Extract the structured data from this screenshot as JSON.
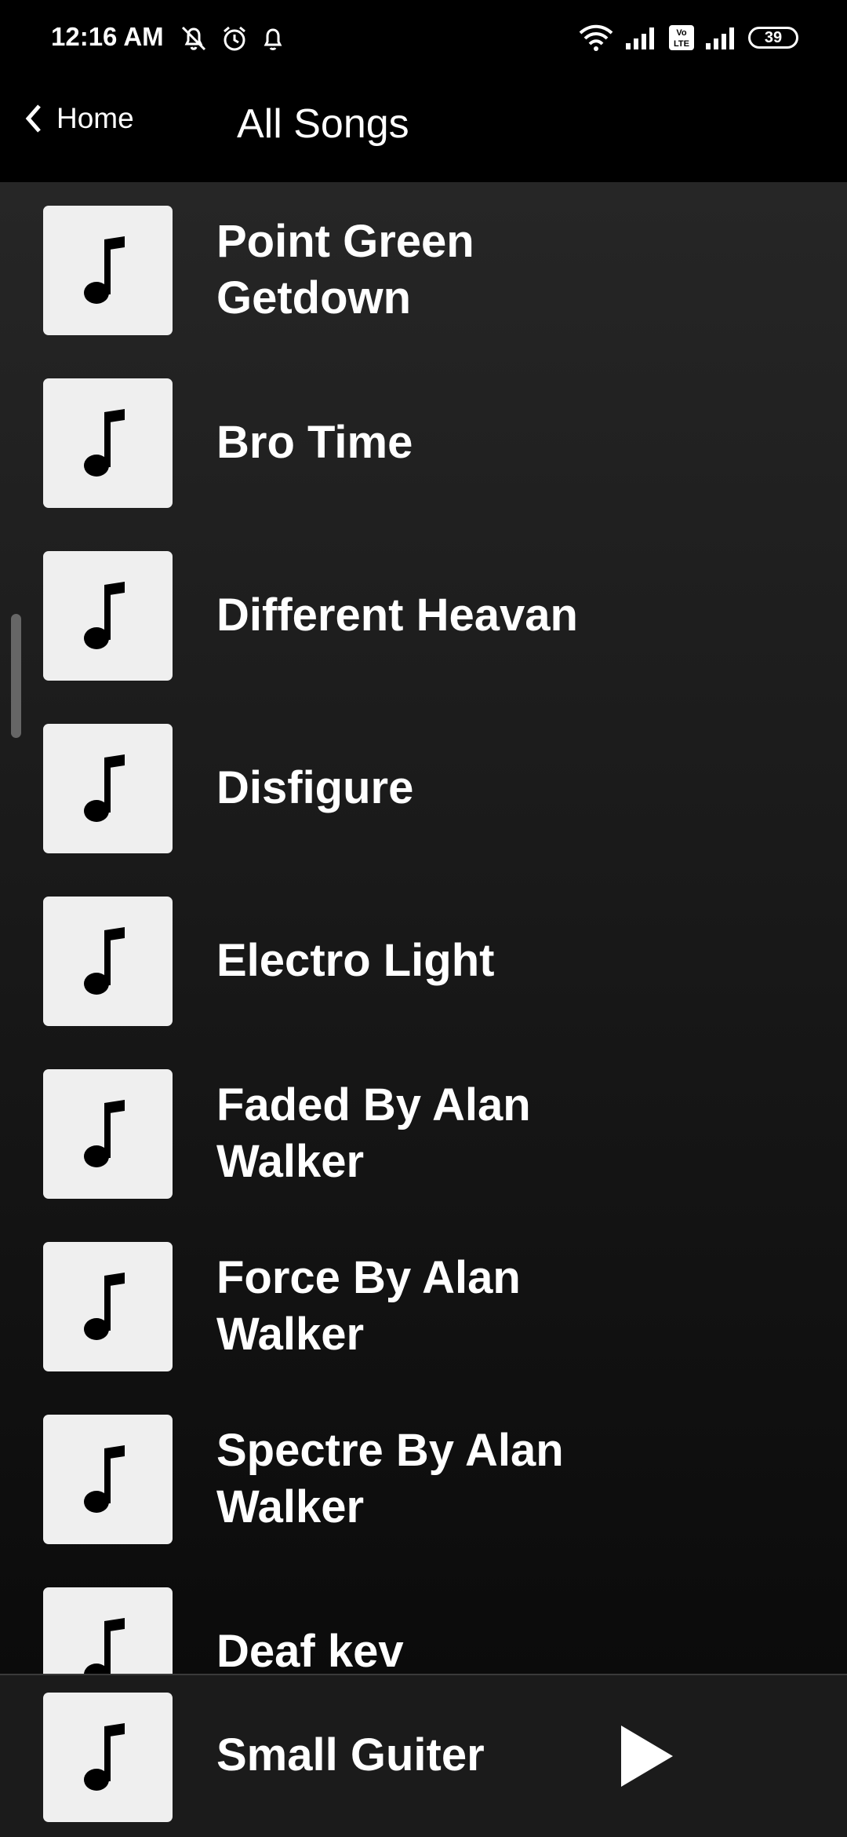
{
  "status_bar": {
    "time": "12:16 AM",
    "battery": "39",
    "volte": "Vo LTE",
    "icons": [
      "mute-icon",
      "alarm-icon",
      "notification-icon",
      "wifi-icon",
      "signal-icon",
      "signal-icon"
    ]
  },
  "header": {
    "back_label": "Home",
    "title": "All Songs"
  },
  "songs": [
    {
      "title": "Point Green Getdown"
    },
    {
      "title": "Bro Time"
    },
    {
      "title": "Different Heavan"
    },
    {
      "title": "Disfigure"
    },
    {
      "title": "Electro Light"
    },
    {
      "title": "Faded By Alan Walker"
    },
    {
      "title": "Force By Alan Walker"
    },
    {
      "title": "Spectre By Alan Walker"
    },
    {
      "title": "Deaf kev"
    }
  ],
  "now_playing": {
    "title": "Small Guiter",
    "icon": "play-icon"
  },
  "colors": {
    "background": "#000000",
    "list_top": "#262626",
    "list_bottom": "#0b0b0b",
    "thumb": "#efefef",
    "text": "#ffffff"
  }
}
